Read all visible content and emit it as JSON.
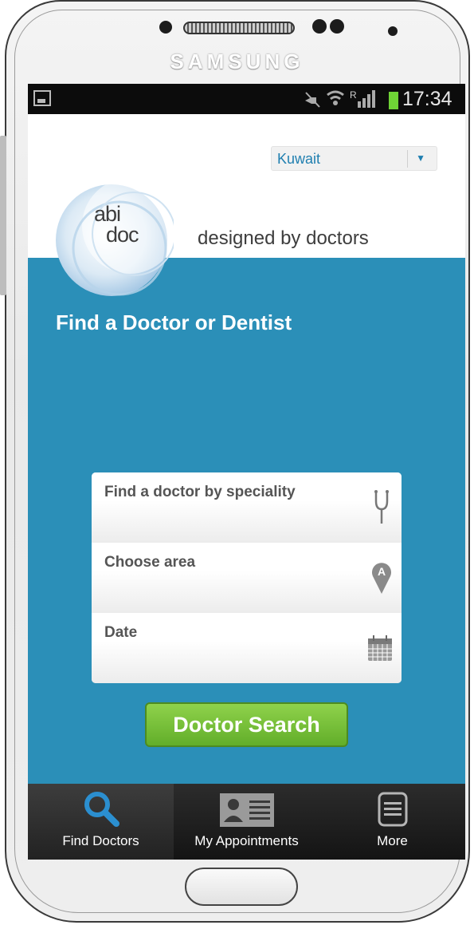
{
  "device": {
    "brand": "SAMSUNG"
  },
  "status_bar": {
    "time": "17:34",
    "battery_color": "#6fd336"
  },
  "header": {
    "country_select": {
      "selected": "Kuwait"
    },
    "logo": {
      "line1": "abi",
      "line2": "doc"
    },
    "tagline": "designed by doctors"
  },
  "main": {
    "title": "Find a Doctor or Dentist",
    "fields": [
      {
        "label": "Find a doctor by speciality",
        "icon": "stethoscope-icon"
      },
      {
        "label": "Choose area",
        "icon": "map-pin-icon"
      },
      {
        "label": "Date",
        "icon": "calendar-icon"
      }
    ],
    "search_button": "Doctor Search"
  },
  "tabs": [
    {
      "label": "Find Doctors",
      "icon": "search-icon",
      "active": true
    },
    {
      "label": "My Appointments",
      "icon": "contact-card-icon",
      "active": false
    },
    {
      "label": "More",
      "icon": "menu-icon",
      "active": false
    }
  ],
  "colors": {
    "accent": "#2b8fb8",
    "button": "#6bb832",
    "tab_bar": "#1c1c1c"
  }
}
